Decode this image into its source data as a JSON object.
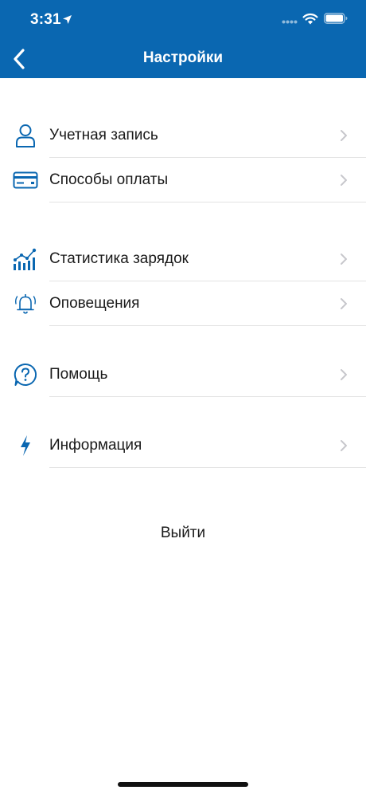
{
  "status_bar": {
    "time": "3:31"
  },
  "nav": {
    "title": "Настройки"
  },
  "menu": {
    "items": [
      {
        "label": "Учетная запись",
        "icon": "user-icon"
      },
      {
        "label": "Способы оплаты",
        "icon": "credit-card-icon"
      },
      {
        "label": "Статистика зарядок",
        "icon": "chart-icon"
      },
      {
        "label": "Оповещения",
        "icon": "bell-icon"
      },
      {
        "label": "Помощь",
        "icon": "help-icon"
      },
      {
        "label": "Информация",
        "icon": "lightning-icon"
      }
    ]
  },
  "logout": {
    "label": "Выйти"
  },
  "colors": {
    "header": "#0a67b1",
    "icon": "#0a67b1",
    "chevron": "#c7c7cc",
    "divider": "#e3e3e3"
  }
}
